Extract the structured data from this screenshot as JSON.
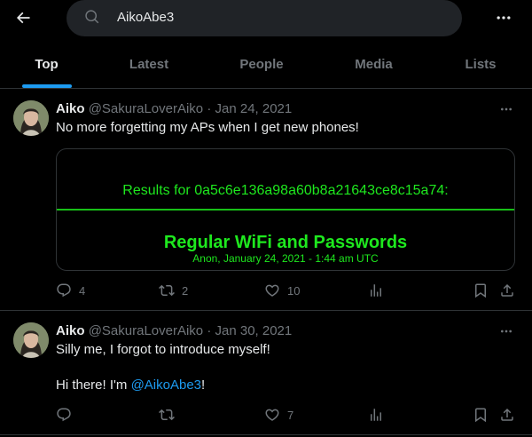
{
  "search": {
    "query": "AikoAbe3"
  },
  "tabs": [
    {
      "label": "Top",
      "active": true
    },
    {
      "label": "Latest",
      "active": false
    },
    {
      "label": "People",
      "active": false
    },
    {
      "label": "Media",
      "active": false
    },
    {
      "label": "Lists",
      "active": false
    }
  ],
  "tweets": [
    {
      "name": "Aiko",
      "handle": "@SakuraLoverAiko",
      "separator": "·",
      "date": "Jan 24, 2021",
      "text": "No more forgetting my APs when I get new phones!",
      "card": {
        "results_line": "Results for 0a5c6e136a98a60b8a21643ce8c15a74:",
        "title": "Regular WiFi and Passwords",
        "subtitle": "Anon, January 24, 2021 - 1:44 am UTC",
        "accent_color": "#1ee81e"
      },
      "replies": "4",
      "retweets": "2",
      "likes": "10"
    },
    {
      "name": "Aiko",
      "handle": "@SakuraLoverAiko",
      "separator": "·",
      "date": "Jan 30, 2021",
      "text_line1": "Silly me, I forgot to introduce myself!",
      "text_line2_prefix": "Hi there! I'm ",
      "text_line2_mention": "@AikoAbe3",
      "text_line2_suffix": "!",
      "replies": "",
      "retweets": "",
      "likes": "7"
    }
  ],
  "icons": {
    "back": "arrow-left-icon",
    "search": "search-icon",
    "more": "more-horizontal-icon",
    "reply": "reply-icon",
    "retweet": "retweet-icon",
    "like": "heart-icon",
    "views": "analytics-icon",
    "bookmark": "bookmark-icon",
    "share": "share-icon"
  },
  "colors": {
    "accent": "#1d9bf0",
    "background": "#000000",
    "muted": "#71767b"
  }
}
